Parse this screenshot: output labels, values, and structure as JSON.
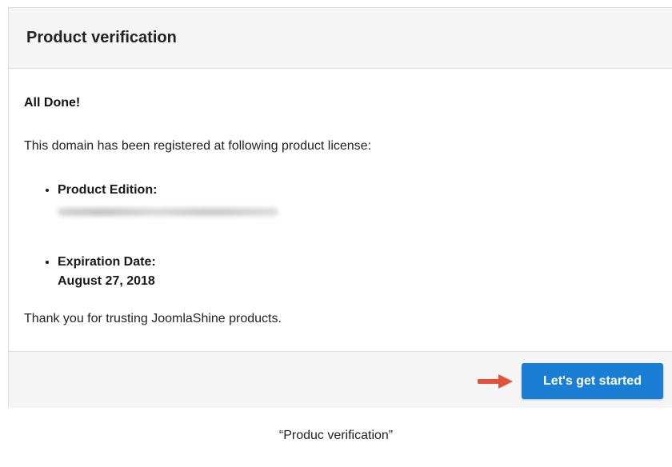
{
  "dialog": {
    "title": "Product verification",
    "heading": "All Done!",
    "intro": "This domain has been registered at following product license:",
    "details": [
      {
        "label": "Product Edition:",
        "value_blurred": true
      },
      {
        "label": "Expiration Date:",
        "value": "August 27, 2018"
      }
    ],
    "thanks": "Thank you for trusting JoomlaShine products.",
    "footer": {
      "button_label": "Let's get started",
      "arrow_icon": "red-arrow-icon"
    }
  },
  "caption": "“Produc verification”",
  "colors": {
    "button": "#1a7fd4",
    "arrow": "#e2513c",
    "header_bg": "#f5f5f5"
  }
}
